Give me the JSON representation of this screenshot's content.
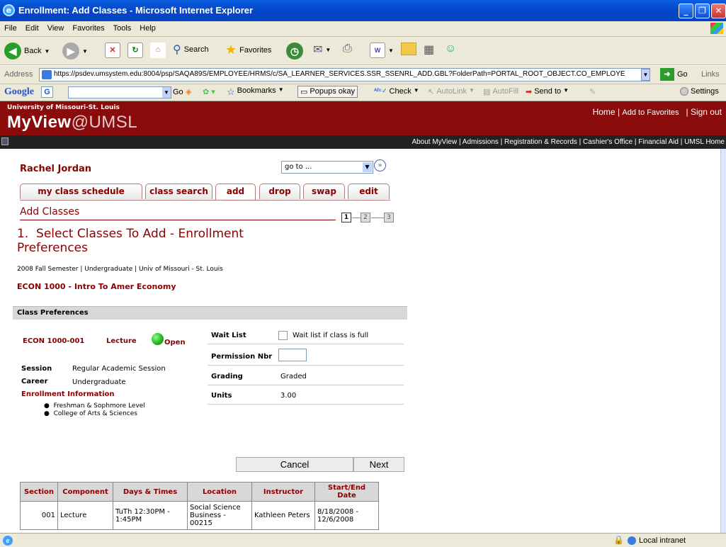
{
  "window": {
    "title": "Enrollment: Add Classes - Microsoft Internet Explorer"
  },
  "menu": [
    "File",
    "Edit",
    "View",
    "Favorites",
    "Tools",
    "Help"
  ],
  "toolbar": {
    "back": "Back",
    "search": "Search",
    "favorites": "Favorites"
  },
  "address": {
    "label": "Address",
    "url": "https://psdev.umsystem.edu:8004/psp/SAQA89S/EMPLOYEE/HRMS/c/SA_LEARNER_SERVICES.SSR_SSENRL_ADD.GBL?FolderPath=PORTAL_ROOT_OBJECT.CO_EMPLOYE",
    "go": "Go",
    "links": "Links"
  },
  "googlebar": {
    "logo": "Google",
    "go": "Go",
    "bookmarks": "Bookmarks",
    "popups": "Popups okay",
    "check": "Check",
    "autolink": "AutoLink",
    "autofill": "AutoFill",
    "sendto": "Send to",
    "settings": "Settings"
  },
  "banner": {
    "university": "University of Missouri-St. Louis",
    "brand": "MyView",
    "brand_at": "@UMSL",
    "home": "Home",
    "add_fav": "Add to Favorites",
    "signout": "Sign out"
  },
  "nav": "About MyView | Admissions | Registration & Records | Cashier's Office | Financial Aid | UMSL Home",
  "student": {
    "name": "Rachel Jordan",
    "goto": "go to ..."
  },
  "tabs": [
    "my class schedule",
    "class search",
    "add",
    "drop",
    "swap",
    "edit"
  ],
  "page": {
    "title": "Add Classes",
    "steps": [
      "1",
      "2",
      "3"
    ],
    "heading": "1.  Select Classes To Add - Enrollment Preferences",
    "term": "2008 Fall Semester | Undergraduate | Univ of Missouri - St. Louis",
    "course": "ECON 1000 - Intro To Amer Economy",
    "section_header": "Class Preferences"
  },
  "prefs": {
    "class_nbr": "ECON 1000-001",
    "component": "Lecture",
    "status": "Open",
    "session_label": "Session",
    "session": "Regular Academic Session",
    "career_label": "Career",
    "career": "Undergraduate",
    "enroll_info_label": "Enrollment Information",
    "enroll_info": [
      "Freshman & Sophmore Level",
      "College of Arts & Sciences"
    ],
    "waitlist_label": "Wait List",
    "waitlist_text": "Wait list if class is full",
    "permission_label": "Permission Nbr",
    "grading_label": "Grading",
    "grading": "Graded",
    "units_label": "Units",
    "units": "3.00"
  },
  "buttons": {
    "cancel": "Cancel",
    "next": "Next"
  },
  "table": {
    "headers": [
      "Section",
      "Component",
      "Days & Times",
      "Location",
      "Instructor",
      "Start/End Date"
    ],
    "rows": [
      [
        "001",
        "Lecture",
        "TuTh 12:30PM - 1:45PM",
        "Social Science Business - 00215",
        "Kathleen Peters",
        "8/18/2008 - 12/6/2008"
      ]
    ]
  },
  "status": {
    "zone": "Local intranet"
  },
  "colors": {
    "brand": "#8a0b0b",
    "accent": "#8b0000",
    "open": "#22aa22"
  }
}
